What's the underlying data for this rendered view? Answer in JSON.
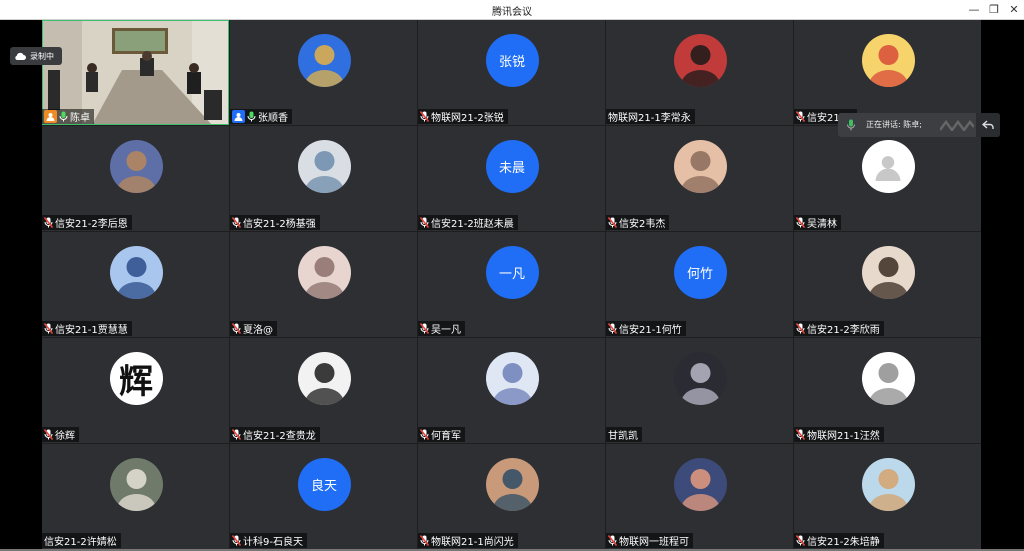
{
  "window": {
    "title": "腾讯会议",
    "min_icon": "minimize-icon",
    "max_icon": "restore-icon",
    "close_icon": "close-icon"
  },
  "recording": {
    "label": "录制中",
    "icon": "cloud-record-icon"
  },
  "speaking": {
    "label": "正在讲话: 陈卓;",
    "icon": "mic-icon",
    "button_icon": "collapse-arrow-icon"
  },
  "colors": {
    "tile_bg": "#2e2f33",
    "avatar_text_bg": "#1f6ef5",
    "host_badge": "#f08a24",
    "cohost_badge": "#1f6ef5"
  },
  "participants": [
    {
      "name": "陈卓",
      "type": "video",
      "role": "host",
      "mic": "on"
    },
    {
      "name": "张顺香",
      "type": "photo",
      "role": "cohost",
      "mic": "on",
      "avatar_icon": "city-bridge-avatar"
    },
    {
      "name": "物联网21-2张锐",
      "type": "text",
      "avatar_text": "张锐",
      "mic": "muted"
    },
    {
      "name": "物联网21-1李常永",
      "type": "photo",
      "mic": "none",
      "avatar_icon": "person-red-avatar"
    },
    {
      "name": "信安21-…",
      "type": "photo",
      "mic": "muted",
      "avatar_icon": "cartoon-avatar"
    },
    {
      "name": "信安21-2李后恩",
      "type": "photo",
      "mic": "muted",
      "avatar_icon": "bear-avatar"
    },
    {
      "name": "信安21-2杨基强",
      "type": "photo",
      "mic": "muted",
      "avatar_icon": "person-avatar"
    },
    {
      "name": "信安21-2班赵未晨",
      "type": "text",
      "avatar_text": "未晨",
      "mic": "muted"
    },
    {
      "name": "信安2韦杰",
      "type": "photo",
      "mic": "muted",
      "avatar_icon": "selfie-avatar"
    },
    {
      "name": "吴清林",
      "type": "default",
      "mic": "muted",
      "avatar_icon": "default-user-avatar"
    },
    {
      "name": "信安21-1贾慧慧",
      "type": "photo",
      "mic": "muted",
      "avatar_icon": "anime-girl-avatar"
    },
    {
      "name": "夏洛@",
      "type": "photo",
      "mic": "muted",
      "avatar_icon": "anime-boy-avatar"
    },
    {
      "name": "吴一凡",
      "type": "text",
      "avatar_text": "一凡",
      "mic": "muted"
    },
    {
      "name": "信安21-1何竹",
      "type": "text",
      "avatar_text": "何竹",
      "mic": "muted"
    },
    {
      "name": "信安21-2李欣雨",
      "type": "photo",
      "mic": "muted",
      "avatar_icon": "girl-photo-avatar"
    },
    {
      "name": "徐辉",
      "type": "glyph",
      "avatar_text": "辉",
      "mic": "muted"
    },
    {
      "name": "信安21-2查贵龙",
      "type": "photo",
      "mic": "muted",
      "avatar_icon": "suit-man-avatar"
    },
    {
      "name": "何育军",
      "type": "photo",
      "mic": "muted",
      "avatar_icon": "anime-blue-hair-avatar"
    },
    {
      "name": "甘凯凯",
      "type": "photo",
      "mic": "none",
      "avatar_icon": "anime-dark-avatar"
    },
    {
      "name": "物联网21-1汪然",
      "type": "photo",
      "mic": "muted",
      "avatar_icon": "sketch-avatar"
    },
    {
      "name": "信安21-2许婧松",
      "type": "photo",
      "mic": "none",
      "avatar_icon": "cartoon-mouse-avatar"
    },
    {
      "name": "计科9-石良天",
      "type": "text",
      "avatar_text": "良天",
      "mic": "muted"
    },
    {
      "name": "物联网21-1尚闪光",
      "type": "photo",
      "mic": "muted",
      "avatar_icon": "window-view-avatar"
    },
    {
      "name": "物联网一班程可",
      "type": "photo",
      "mic": "muted",
      "avatar_icon": "sunset-avatar"
    },
    {
      "name": "信安21-2朱培静",
      "type": "photo",
      "mic": "muted",
      "avatar_icon": "landscape-avatar"
    }
  ]
}
